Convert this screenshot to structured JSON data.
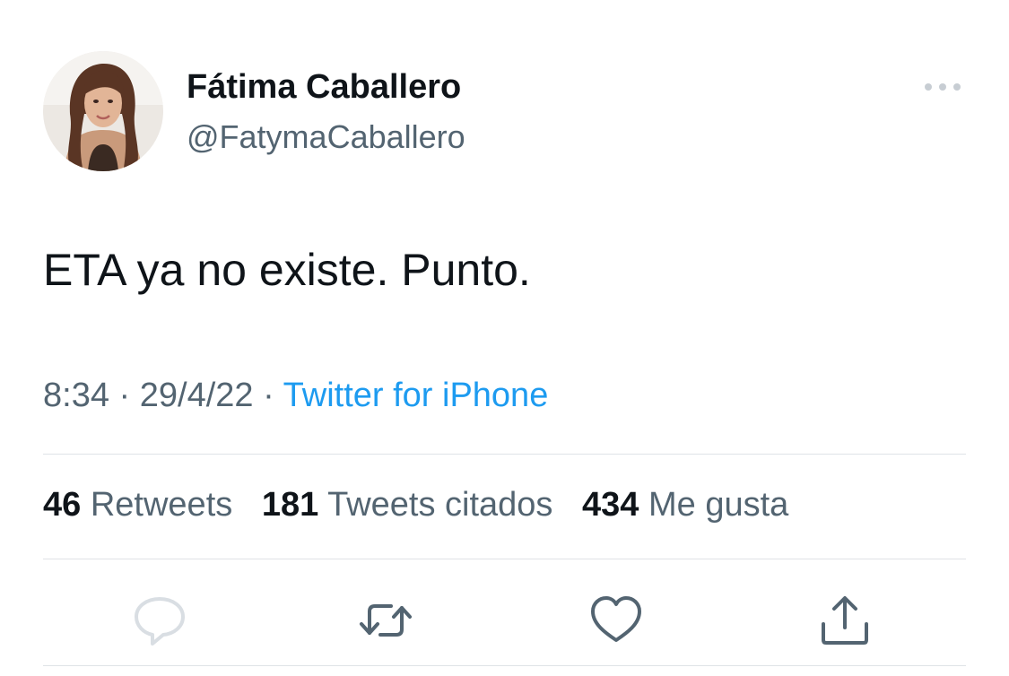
{
  "author": {
    "name": "Fátima Caballero",
    "handle": "@FatymaCaballero",
    "avatar_icon": "profile-photo"
  },
  "tweet": {
    "text": "ETA ya no existe. Punto.",
    "time": "8:34",
    "date": "29/4/22",
    "separator": " · ",
    "source": "Twitter for iPhone"
  },
  "stats": {
    "retweets_count": "46",
    "retweets_label": "Retweets",
    "quotes_count": "181",
    "quotes_label": "Tweets citados",
    "likes_count": "434",
    "likes_label": "Me gusta"
  },
  "actions": {
    "reply_icon": "reply-icon",
    "retweet_icon": "retweet-icon",
    "like_icon": "heart-icon",
    "share_icon": "share-icon"
  },
  "colors": {
    "text_primary": "#0f1419",
    "text_secondary": "#536471",
    "link": "#1d9bf0",
    "divider": "#dfe3e7",
    "icon": "#536471"
  }
}
